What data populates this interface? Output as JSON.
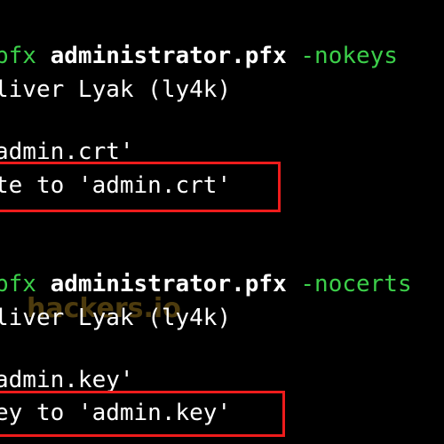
{
  "colors": {
    "background": "#000000",
    "text": "#ffffff",
    "command": "#3ccf4a",
    "highlight_box": "#ee1c1c"
  },
  "block1": {
    "cmd_tail": "pfx",
    "file": "administrator.pfx",
    "flag": "-nokeys",
    "author": "liver Lyak (ly4k)",
    "msg_tail": "admin.crt'",
    "result": "te to 'admin.crt'"
  },
  "block2": {
    "cmd_tail": "pfx",
    "file": "administrator.pfx",
    "flag": "-nocerts",
    "author": "liver Lyak (ly4k)",
    "watermark": "hackers.io",
    "msg_tail": "admin.key'",
    "result": "ey to 'admin.key'"
  }
}
